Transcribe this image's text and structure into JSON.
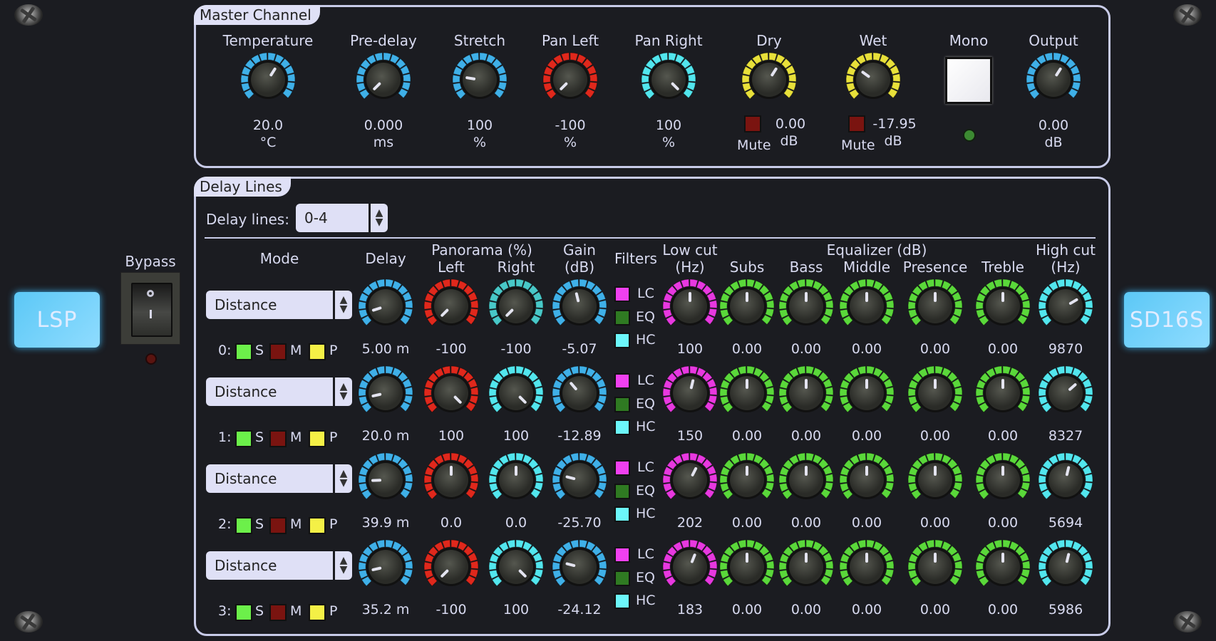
{
  "brand": {
    "left_logo": "LSP",
    "right_logo": "SD16S"
  },
  "bypass": {
    "label": "Bypass",
    "state": "on",
    "switch_top": "O",
    "switch_bottom": "I"
  },
  "colors": {
    "blue": "#3fb0e8",
    "red": "#e0281c",
    "cyan": "#52e6ee",
    "yellow": "#e8e03a",
    "magenta": "#e838e0",
    "green": "#5ad83a",
    "teal": "#48c8c8",
    "led_green": "#6cf04a",
    "led_red_off": "#7a1410",
    "led_yellow": "#f4f046",
    "led_magenta": "#f040f0",
    "led_darkgreen": "#2f7a22",
    "led_cyan": "#6cf6fa"
  },
  "master": {
    "title": "Master Channel",
    "controls": [
      {
        "label": "Temperature",
        "value": "20.0",
        "unit": "°C",
        "color": "blue",
        "pos": 0.62
      },
      {
        "label": "Pre-delay",
        "value": "0.000",
        "unit": "ms",
        "color": "blue",
        "pos": 0.0
      },
      {
        "label": "Stretch",
        "value": "100",
        "unit": "%",
        "color": "blue",
        "pos": 0.2
      },
      {
        "label": "Pan Left",
        "value": "-100",
        "unit": "%",
        "color": "red",
        "pos": 0.0
      },
      {
        "label": "Pan Right",
        "value": "100",
        "unit": "%",
        "color": "cyan",
        "pos": 1.0
      },
      {
        "label": "Dry",
        "value": "0.00",
        "unit": "dB",
        "color": "yellow",
        "pos": 0.62,
        "mute_label": "Mute"
      },
      {
        "label": "Wet",
        "value": "-17.95",
        "unit": "dB",
        "color": "yellow",
        "pos": 0.3,
        "mute_label": "Mute"
      },
      {
        "label": "Mono",
        "type": "button",
        "state": "off"
      },
      {
        "label": "Output",
        "value": "0.00",
        "unit": "dB",
        "color": "blue",
        "pos": 0.62
      }
    ]
  },
  "delay": {
    "title": "Delay Lines",
    "selector_label": "Delay lines:",
    "selector_value": "0-4",
    "headers": {
      "mode": "Mode",
      "delay": "Delay",
      "panorama": "Panorama (%)",
      "left": "Left",
      "right": "Right",
      "gain": "Gain",
      "gain_unit": "(dB)",
      "filters": "Filters",
      "lowcut": "Low cut",
      "lowcut_unit": "(Hz)",
      "equalizer": "Equalizer (dB)",
      "subs": "Subs",
      "bass": "Bass",
      "middle": "Middle",
      "presence": "Presence",
      "treble": "Treble",
      "highcut": "High cut",
      "highcut_unit": "(Hz)"
    },
    "toggle_labels": {
      "solo": "S",
      "mute": "M",
      "phase": "P",
      "lc": "LC",
      "eq": "EQ",
      "hc": "HC"
    },
    "rows": [
      {
        "index": "0:",
        "mode": "Distance",
        "delay": "5.00 m",
        "left": "-100",
        "right": "-100",
        "gain": "-5.07",
        "lowcut": "100",
        "subs": "0.00",
        "bass": "0.00",
        "middle": "0.00",
        "presence": "0.00",
        "treble": "0.00",
        "highcut": "9870",
        "pos": {
          "delay": 0.1,
          "left": 0.0,
          "right": 0.0,
          "gain": 0.45,
          "lowcut": 0.5,
          "highcut": 0.72
        }
      },
      {
        "index": "1:",
        "mode": "Distance",
        "delay": "20.0 m",
        "left": "100",
        "right": "100",
        "gain": "-12.89",
        "lowcut": "150",
        "subs": "0.00",
        "bass": "0.00",
        "middle": "0.00",
        "presence": "0.00",
        "treble": "0.00",
        "highcut": "8327",
        "pos": {
          "delay": 0.12,
          "left": 1.0,
          "right": 1.0,
          "gain": 0.35,
          "lowcut": 0.55,
          "highcut": 0.68
        }
      },
      {
        "index": "2:",
        "mode": "Distance",
        "delay": "39.9 m",
        "left": "0.0",
        "right": "0.0",
        "gain": "-25.70",
        "lowcut": "202",
        "subs": "0.00",
        "bass": "0.00",
        "middle": "0.00",
        "presence": "0.00",
        "treble": "0.00",
        "highcut": "5694",
        "pos": {
          "delay": 0.16,
          "left": 0.5,
          "right": 0.5,
          "gain": 0.22,
          "lowcut": 0.6,
          "highcut": 0.55
        }
      },
      {
        "index": "3:",
        "mode": "Distance",
        "delay": "35.2 m",
        "left": "-100",
        "right": "100",
        "gain": "-24.12",
        "lowcut": "183",
        "subs": "0.00",
        "bass": "0.00",
        "middle": "0.00",
        "presence": "0.00",
        "treble": "0.00",
        "highcut": "5986",
        "pos": {
          "delay": 0.12,
          "left": 0.0,
          "right": 1.0,
          "gain": 0.22,
          "lowcut": 0.58,
          "highcut": 0.55
        }
      }
    ]
  }
}
